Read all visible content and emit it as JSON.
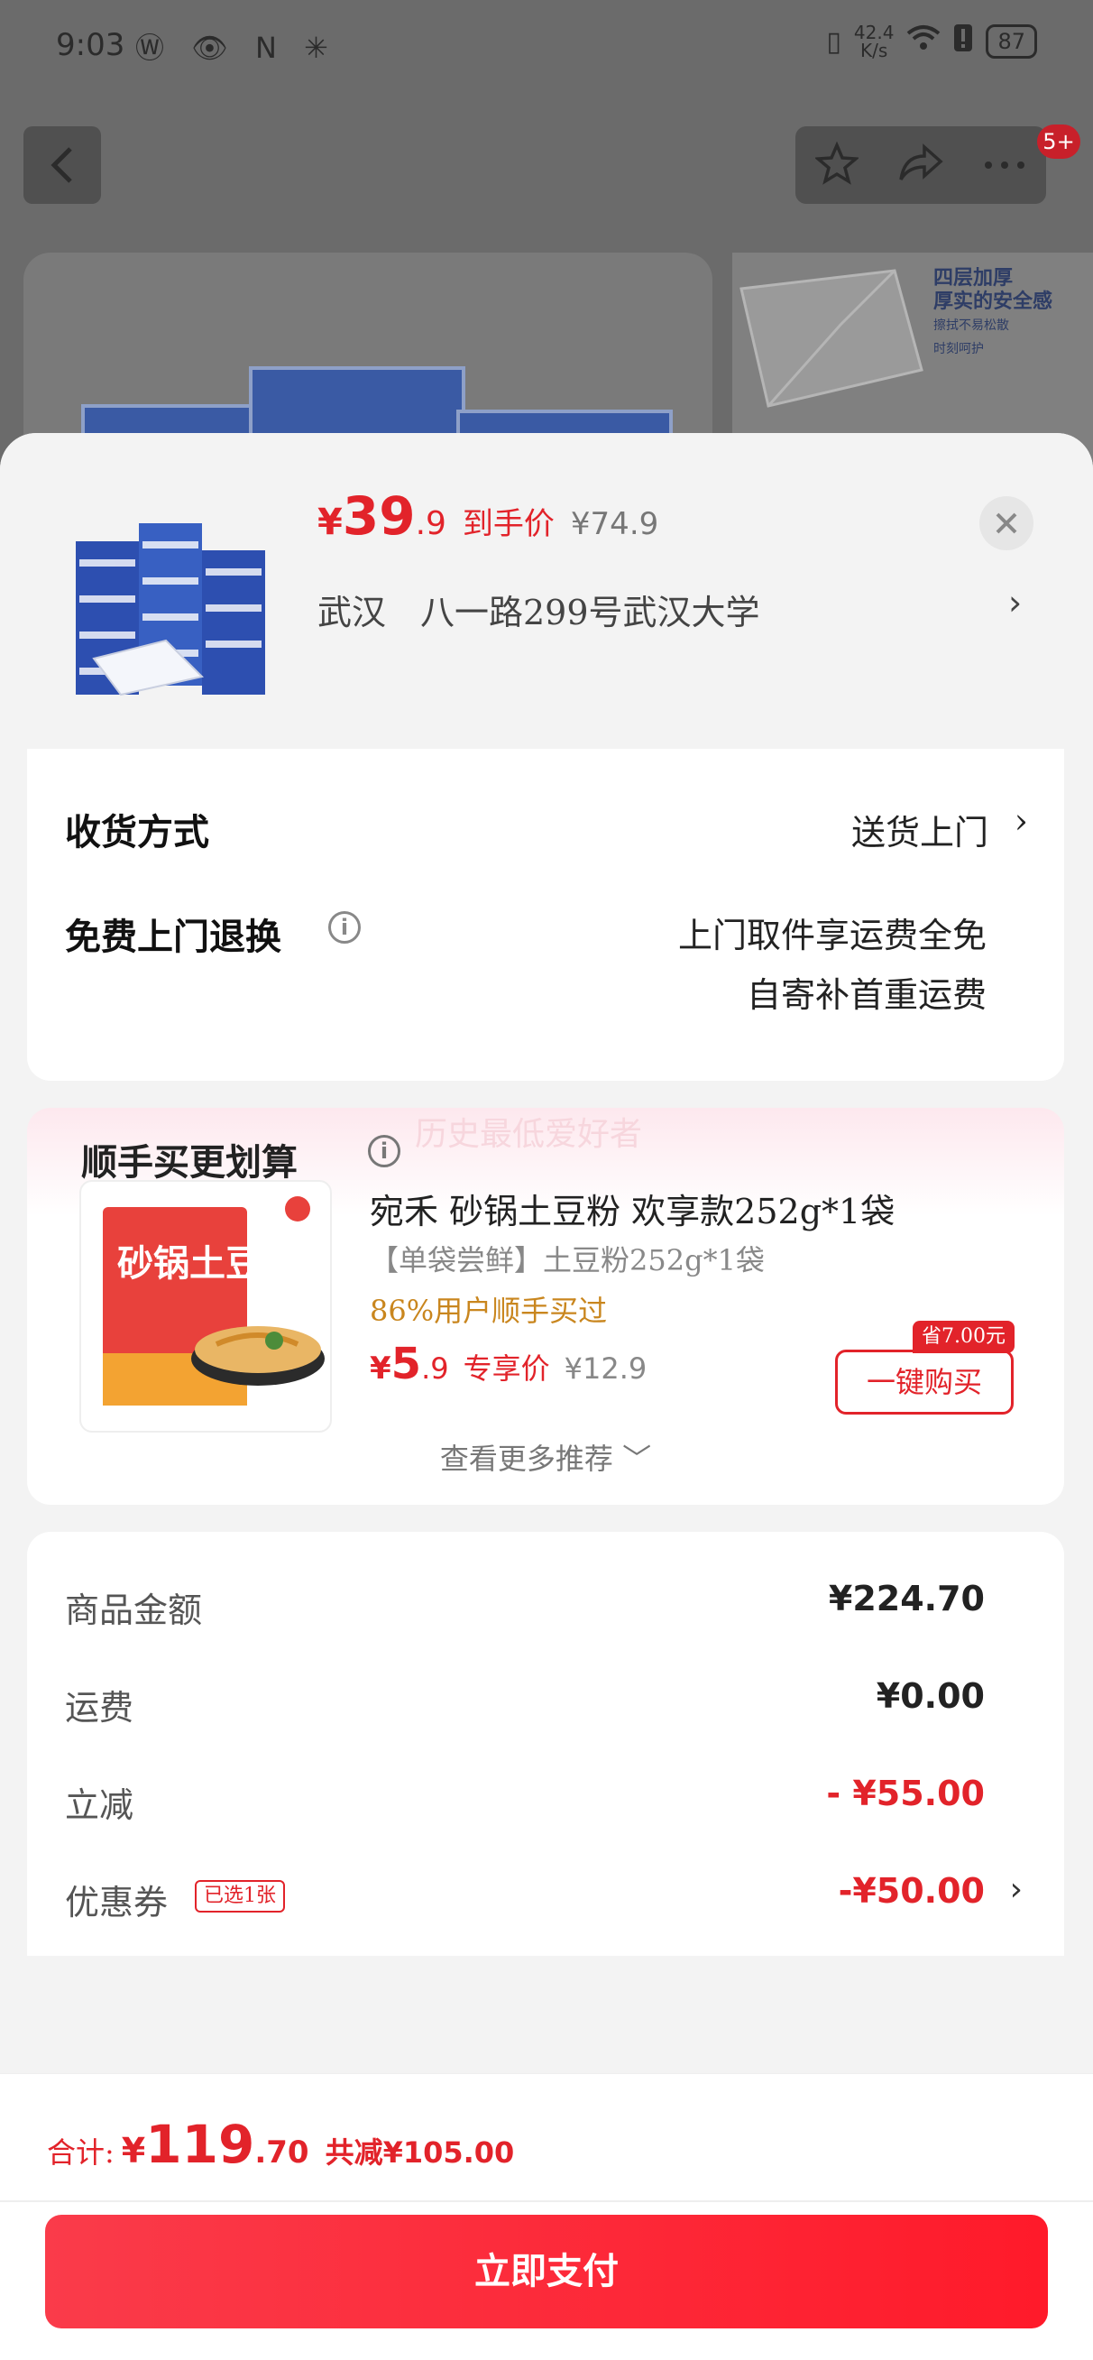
{
  "status_bar": {
    "time": "9:03",
    "left_icons": "Ⓦ 👁 N ✳",
    "net_speed_value": "42.4",
    "net_speed_unit": "K/s",
    "battery": "87"
  },
  "nav": {
    "badge": "5+"
  },
  "background": {
    "banner_line1": "四层加厚",
    "banner_line2": "厚实的安全感",
    "banner_line3": "擦拭不易松散",
    "banner_line4": "时刻呵护"
  },
  "sheet": {
    "price": {
      "yen": "¥",
      "integer": "39",
      "decimal": ".9",
      "tag": "到手价",
      "original": "¥74.9"
    },
    "address": "武汉　八一路299号武汉大学",
    "address_chevron": "›"
  },
  "delivery": {
    "method_label": "收货方式",
    "method_value": "送货上门",
    "method_chevron": "›",
    "return_label": "免费上门退换",
    "return_value_line1": "上门取件享运费全免",
    "return_value_line2": "自寄补首重运费"
  },
  "recommend": {
    "ghost_text": "历史最低爱好者",
    "title": "顺手买更划算",
    "item": {
      "name": "宛禾 砂锅土豆粉 欢享款252g*1袋",
      "spec": "【单袋尝鲜】土豆粉252g*1袋",
      "buyers": "86%用户顺手买过",
      "price_yen": "¥",
      "price_integer": "5",
      "price_decimal": ".9",
      "price_tag": "专享价",
      "price_original": "¥12.9",
      "save_tag": "省7.00元",
      "buy_label": "一键购买",
      "image_title": "砂锅土豆粉"
    },
    "more": "查看更多推荐 ﹀"
  },
  "summary": {
    "rows": [
      {
        "label": "商品金额",
        "value": "¥224.70"
      },
      {
        "label": "运费",
        "value": "¥0.00"
      },
      {
        "label": "立减",
        "value": "- ¥55.00"
      },
      {
        "label": "优惠券",
        "value": "-¥50.00",
        "tag": "已选1张"
      }
    ]
  },
  "bottom": {
    "total_label": "合计:",
    "total_yen": "¥",
    "total_integer": "119",
    "total_decimal": ".70",
    "total_saved": "共减¥105.00",
    "pay_label": "立即支付"
  },
  "colors": {
    "accent": "#e2232a",
    "buyers": "#c9861e"
  }
}
